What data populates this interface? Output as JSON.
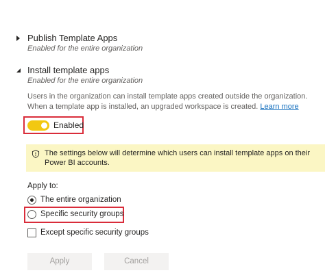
{
  "sections": [
    {
      "title": "Publish Template Apps",
      "subtitle": "Enabled for the entire organization",
      "expanded": false
    },
    {
      "title": "Install template apps",
      "subtitle": "Enabled for the entire organization",
      "expanded": true
    }
  ],
  "description": {
    "text": "Users in the organization can install template apps created outside the organization. When a template app is installed, an upgraded workspace is created.",
    "link": "Learn more"
  },
  "toggle": {
    "label": "Enabled",
    "on": true,
    "color": "#f2c811"
  },
  "banner": {
    "icon": "shield-icon",
    "text": "The settings below will determine which users can install template apps on their Power BI accounts.",
    "color": "#fbf6c4"
  },
  "apply_to": {
    "label": "Apply to:",
    "options": [
      {
        "label": "The entire organization",
        "selected": true
      },
      {
        "label": "Specific security groups",
        "selected": false
      }
    ],
    "except_label": "Except specific security groups",
    "except_checked": false
  },
  "buttons": {
    "apply": "Apply",
    "cancel": "Cancel"
  },
  "colors": {
    "highlight_box": "#d92c3a",
    "link": "#0f6cbd"
  }
}
